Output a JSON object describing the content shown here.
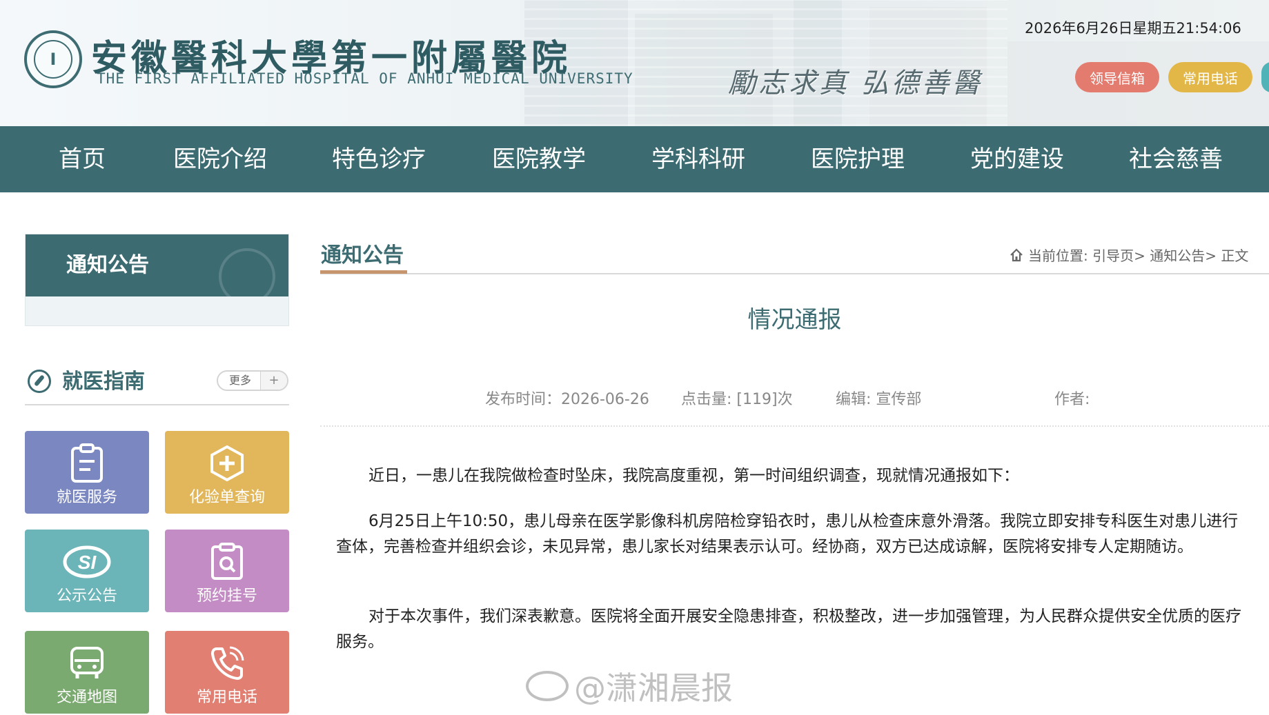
{
  "header": {
    "logo_cn": "安徽醫科大學第一附屬醫院",
    "logo_en": "THE FIRST AFFILIATED HOSPITAL OF ANHUI MEDICAL UNIVERSITY",
    "motto": "勵志求真 弘德善醫",
    "datetime": "2026年6月26日星期五21:54:06",
    "buttons": {
      "leader_mail": "领导信箱",
      "phone": "常用电话"
    }
  },
  "nav": {
    "items": [
      "首页",
      "医院介绍",
      "特色诊疗",
      "医院教学",
      "学科科研",
      "医院护理",
      "党的建设",
      "社会慈善"
    ]
  },
  "sidebar": {
    "notice_title": "通知公告",
    "guide_title": "就医指南",
    "more_label": "更多",
    "more_plus": "+",
    "tiles": [
      {
        "label": "就医服务",
        "icon": "clipboard-icon",
        "color": "#7b87c0"
      },
      {
        "label": "化验单查询",
        "icon": "medical-cross-icon",
        "color": "#e2b75c"
      },
      {
        "label": "公示公告",
        "icon": "si-logo-icon",
        "color": "#6bb4b8"
      },
      {
        "label": "预约挂号",
        "icon": "appointment-search-icon",
        "color": "#c48cc4"
      },
      {
        "label": "交通地图",
        "icon": "bus-icon",
        "color": "#7aaa6f"
      },
      {
        "label": "常用电话",
        "icon": "phone-icon",
        "color": "#e07f72"
      }
    ]
  },
  "main": {
    "tab_title": "通知公告",
    "breadcrumb": "当前位置:  引导页> 通知公告> 正文",
    "article_title": "情况通报",
    "meta": {
      "publish": "发布时间：2026-06-26",
      "clicks": "点击量:   [119]次",
      "editor": "编辑:   宣传部",
      "author": "作者:"
    },
    "paragraphs": [
      "近日，一患儿在我院做检查时坠床，我院高度重视，第一时间组织调查，现就情况通报如下：",
      "6月25日上午10:50，患儿母亲在医学影像科机房陪检穿铅衣时，患儿从检查床意外滑落。我院立即安排专科医生对患儿进行查体，完善检查并组织会诊，未见异常，患儿家长对结果表示认可。经协商，双方已达成谅解，医院将安排专人定期随访。",
      "对于本次事件，我们深表歉意。医院将全面开展安全隐患排查，积极整改，进一步加强管理，为人民群众提供安全优质的医疗服务。"
    ]
  },
  "watermark": "@潇湘晨报"
}
